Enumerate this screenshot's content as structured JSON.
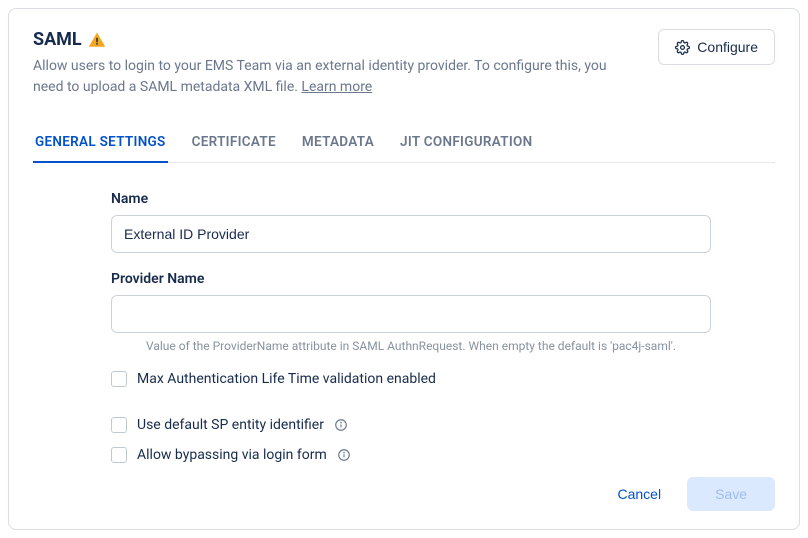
{
  "header": {
    "title": "SAML",
    "subtitle_prefix": "Allow users to login to your EMS Team via an external identity provider. To configure this, you need to upload a SAML metadata XML file. ",
    "learn_more": "Learn more",
    "configure_label": "Configure"
  },
  "tabs": [
    {
      "label": "GENERAL SETTINGS",
      "active": true
    },
    {
      "label": "CERTIFICATE",
      "active": false
    },
    {
      "label": "METADATA",
      "active": false
    },
    {
      "label": "JIT CONFIGURATION",
      "active": false
    }
  ],
  "form": {
    "name_label": "Name",
    "name_value": "External ID Provider",
    "provider_label": "Provider Name",
    "provider_value": "",
    "provider_helper": "Value of the ProviderName attribute in SAML AuthnRequest. When empty the default is 'pac4j-saml'.",
    "check_max_auth": "Max Authentication Life Time validation enabled",
    "check_default_sp": "Use default SP entity identifier",
    "check_bypass": "Allow bypassing via login form"
  },
  "footer": {
    "cancel": "Cancel",
    "save": "Save"
  }
}
